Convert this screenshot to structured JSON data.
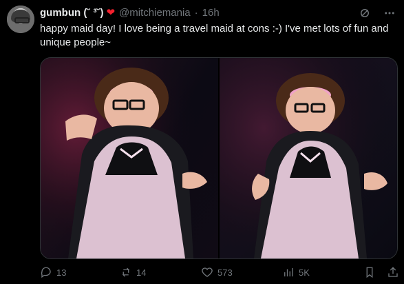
{
  "tweet": {
    "author_name": "gumbun (˘ ³˘)",
    "handle": "@mitchiemania",
    "time": "16h",
    "text": "happy maid day! I love being a travel maid at cons :-) I've met lots of fun and unique people~"
  },
  "actions": {
    "replies": "13",
    "reposts": "14",
    "likes": "573",
    "views": "5K"
  },
  "colors": {
    "background": "#000000",
    "text": "#e7e9ea",
    "muted": "#71767b",
    "heart": "#f4212e"
  },
  "icons": [
    "grok-icon",
    "more-icon",
    "reply-icon",
    "repost-icon",
    "like-icon",
    "views-icon",
    "bookmark-icon",
    "share-icon"
  ]
}
